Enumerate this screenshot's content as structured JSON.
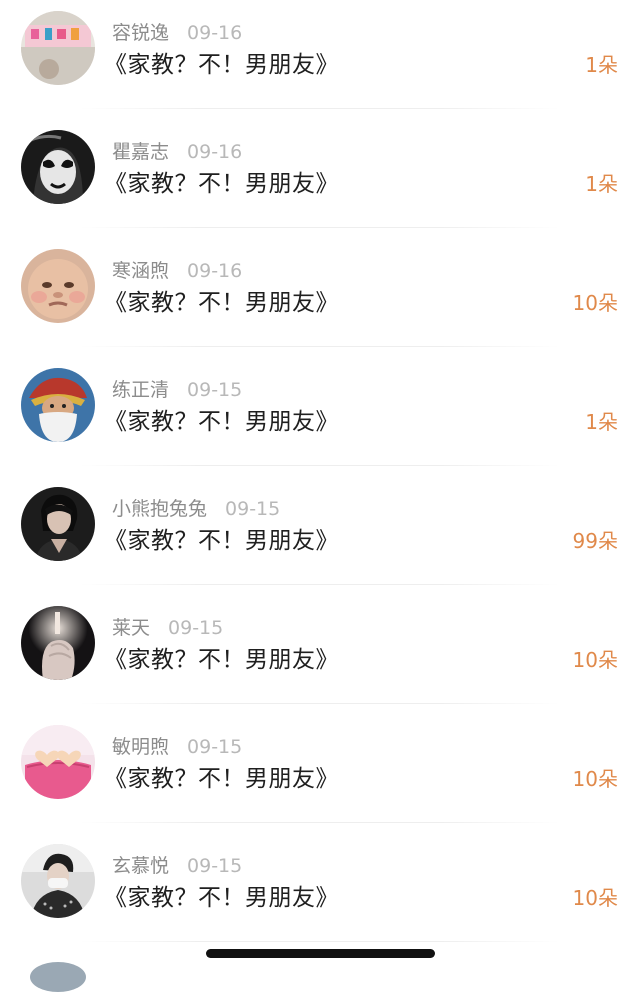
{
  "gift_list": {
    "rows": [
      {
        "username": "容锐逸",
        "date": "09-16",
        "title": "《家教？不！男朋友》",
        "gift": "1朵",
        "avatar_icon": "avatar-toddler-pink-banner-icon"
      },
      {
        "username": "瞿嘉志",
        "date": "09-16",
        "title": "《家教？不！男朋友》",
        "gift": "1朵",
        "avatar_icon": "avatar-face-paint-bw-icon"
      },
      {
        "username": "寒涵煦",
        "date": "09-16",
        "title": "《家教？不！男朋友》",
        "gift": "10朵",
        "avatar_icon": "avatar-baby-face-icon"
      },
      {
        "username": "练正清",
        "date": "09-15",
        "title": "《家教？不！男朋友》",
        "gift": "1朵",
        "avatar_icon": "avatar-bearded-warrior-icon"
      },
      {
        "username": "小熊抱兔兔",
        "date": "09-15",
        "title": "《家教？不！男朋友》",
        "gift": "99朵",
        "avatar_icon": "avatar-dark-portrait-icon"
      },
      {
        "username": "莱天",
        "date": "09-15",
        "title": "《家教？不！男朋友》",
        "gift": "10朵",
        "avatar_icon": "avatar-hand-light-icon"
      },
      {
        "username": "敏明煦",
        "date": "09-15",
        "title": "《家教？不！男朋友》",
        "gift": "10朵",
        "avatar_icon": "avatar-pink-hearts-icon"
      },
      {
        "username": "玄慕悦",
        "date": "09-15",
        "title": "《家教？不！男朋友》",
        "gift": "10朵",
        "avatar_icon": "avatar-masked-person-icon"
      }
    ]
  },
  "colors": {
    "gift": "#e0894a",
    "username": "#8c8c8c",
    "date": "#b8b8b8",
    "title": "#1f1f1f"
  }
}
